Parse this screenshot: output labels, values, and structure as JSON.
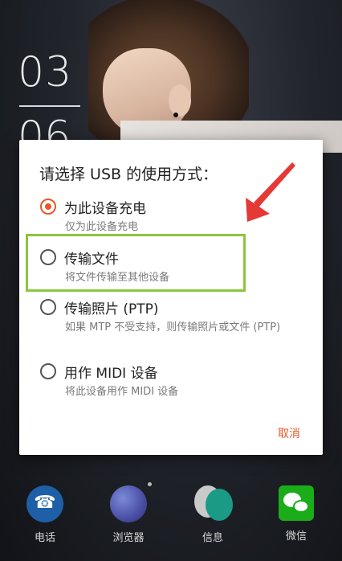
{
  "lockscreen": {
    "clock_hour": "03",
    "clock_minute": "06"
  },
  "dialog": {
    "title": "请选择 USB 的使用方式：",
    "options": [
      {
        "label": "为此设备充电",
        "description": "仅为此设备充电",
        "selected": true
      },
      {
        "label": "传输文件",
        "description": "将文件传输至其他设备",
        "selected": false
      },
      {
        "label": "传输照片 (PTP)",
        "description": "如果 MTP 不受支持，则传输照片或文件 (PTP)",
        "selected": false
      },
      {
        "label": "用作 MIDI 设备",
        "description": "将此设备用作 MIDI 设备",
        "selected": false
      }
    ],
    "cancel_label": "取消"
  },
  "dock": {
    "items": [
      {
        "label": "电话",
        "icon": "phone-icon"
      },
      {
        "label": "浏览器",
        "icon": "browser-icon"
      },
      {
        "label": "信息",
        "icon": "messages-icon"
      },
      {
        "label": "微信",
        "icon": "wechat-icon"
      }
    ]
  },
  "colors": {
    "accent": "#e5582b",
    "highlight": "#8cc63f",
    "arrow": "#e53935"
  }
}
